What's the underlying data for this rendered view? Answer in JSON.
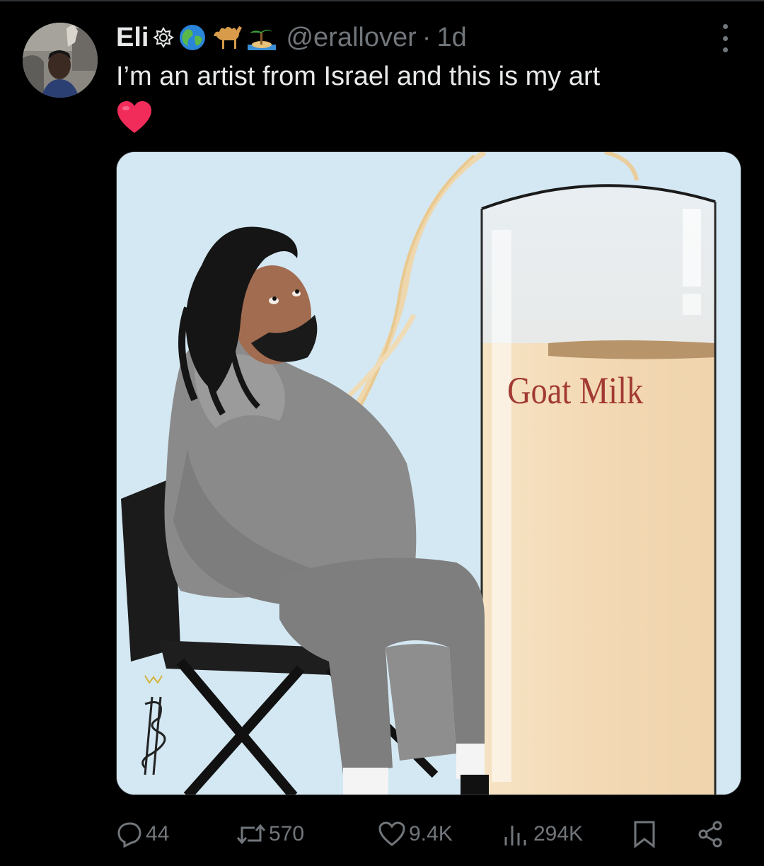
{
  "post": {
    "display_name": "Eli",
    "handle": "@erallover",
    "separator": "·",
    "time": "1d",
    "text": "I’m an artist from Israel and this is my art",
    "name_emojis": [
      "badge-icon",
      "globe-icon",
      "camel-icon",
      "island-icon"
    ],
    "text_emoji": "heart-icon"
  },
  "media": {
    "label": "Goat Milk",
    "alt_description_visible": false,
    "signature_initials": "JCS"
  },
  "actions": {
    "replies": "44",
    "reposts": "570",
    "likes": "9.4K",
    "views": "294K"
  },
  "colors": {
    "background": "#000000",
    "text_primary": "#e7e9ea",
    "text_secondary": "#71767b",
    "heart": "#f91880",
    "label_red": "#a23a33"
  }
}
